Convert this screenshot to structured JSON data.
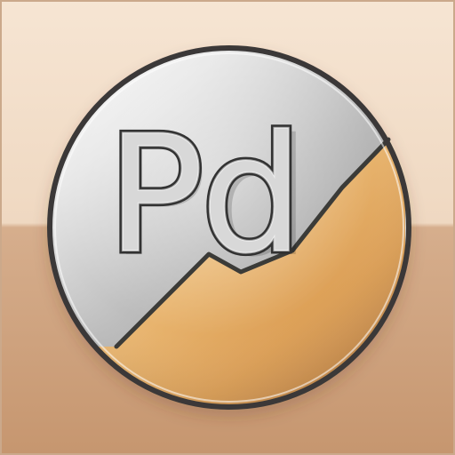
{
  "icon": {
    "name": "Pd app icon",
    "letters": "Pd",
    "colors": {
      "background_top": "#f6e5d3",
      "background_mid": "#f0d9c2",
      "background_band": "#d5ad8b",
      "background_bottom": "#c79a74",
      "silver_light": "#f4f4f4",
      "silver_mid": "#c9c9c9",
      "silver_dark": "#8d8d8d",
      "gold_light": "#f6d28f",
      "gold_mid": "#e7b56a",
      "gold_dark": "#b8793e",
      "outline": "#3b3a37"
    }
  }
}
